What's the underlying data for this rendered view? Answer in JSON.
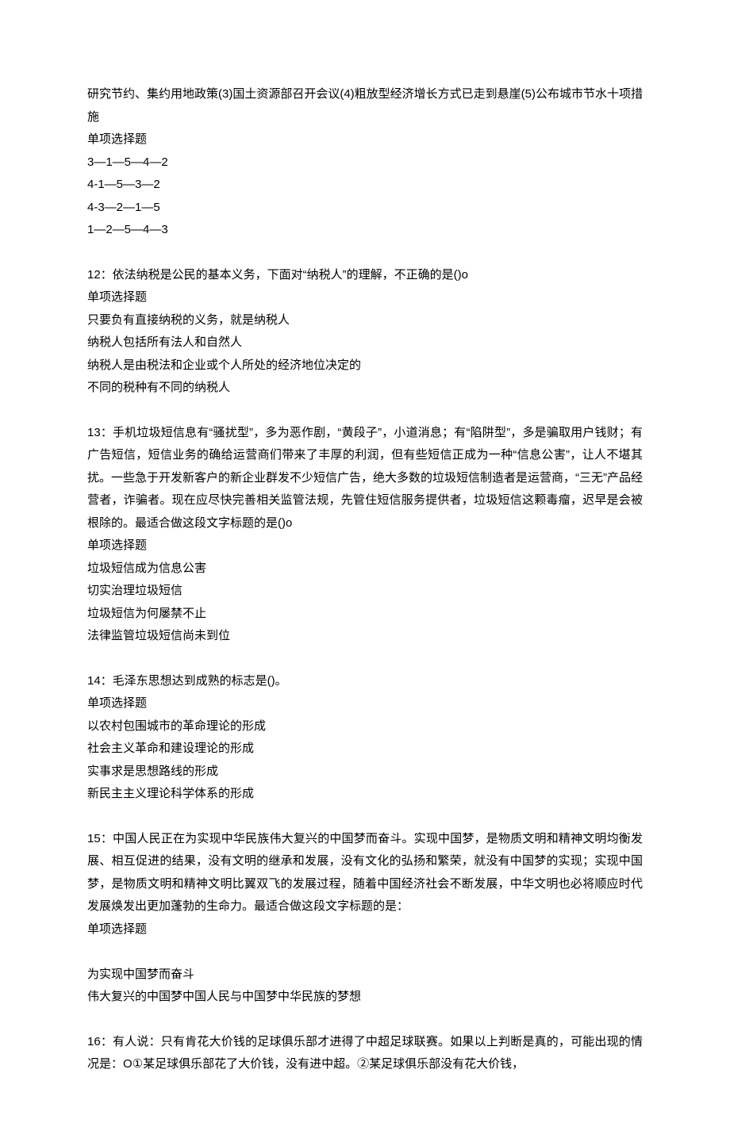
{
  "q11_partial": {
    "intro": "研究节约、集约用地政策(3)国土资源部召开会议(4)粗放型经济增长方式已走到悬崖(5)公布城市节水十项措施",
    "type": "单项选择题",
    "options": [
      "3—1—5—4—2",
      "4-1—5—3—2",
      "4-3—2—1—5",
      "1—2—5—4—3"
    ]
  },
  "q12": {
    "stem": "12：依法纳税是公民的基本义务，下面对“纳税人”的理解，不正确的是()o",
    "type": "单项选择题",
    "options": [
      "只要负有直接纳税的义务，就是纳税人",
      "纳税人包括所有法人和自然人",
      "纳税人是由税法和企业或个人所处的经济地位决定的",
      "不同的税种有不同的纳税人"
    ]
  },
  "q13": {
    "stem": "13：手机垃圾短信息有“骚扰型”，多为恶作剧，“黄段子”，小道消息；有“陷阱型”，多是骗取用户钱财；有广告短信，短信业务的确给运营商们带来了丰厚的利润，但有些短信正成为一种“信息公害”，让人不堪其扰。一些急于开发新客户的新企业群发不少短信广告，绝大多数的垃圾短信制造者是运营商，“三无”产品经营者，诈骗者。现在应尽快完善相关监管法规，先管住短信服务提供者，垃圾短信这颗毒瘤，迟早是会被根除的。最适合做这段文字标题的是()o",
    "type": "单项选择题",
    "options": [
      "垃圾短信成为信息公害",
      "切实治理垃圾短信",
      "垃圾短信为何屡禁不止",
      "法律监管垃圾短信尚未到位"
    ]
  },
  "q14": {
    "stem": "14：毛泽东思想达到成熟的标志是()。",
    "type": "单项选择题",
    "options": [
      "以农村包围城市的革命理论的形成",
      "社会主义革命和建设理论的形成",
      "实事求是思想路线的形成",
      "新民主主义理论科学体系的形成"
    ]
  },
  "q15": {
    "stem": "15：中国人民正在为实现中华民族伟大复兴的中国梦而奋斗。实现中国梦，是物质文明和精神文明均衡发展、相互促进的结果，没有文明的继承和发展，没有文化的弘扬和繁荣，就没有中国梦的实现；实现中国梦，是物质文明和精神文明比翼双飞的发展过程，随着中国经济社会不断发展，中华文明也必将顺应时代发展焕发出更加蓬勃的生命力。最适合做这段文字标题的是：",
    "type": "单项选择题",
    "options": [
      "为实现中国梦而奋斗",
      "伟大复兴的中国梦中国人民与中国梦中华民族的梦想"
    ]
  },
  "q16_partial": {
    "stem": "16：有人说：只有肯花大价钱的足球俱乐部才进得了中超足球联赛。如果以上判断是真的，可能出现的情况是：O①某足球俱乐部花了大价钱，没有进中超。②某足球俱乐部没有花大价钱，"
  }
}
